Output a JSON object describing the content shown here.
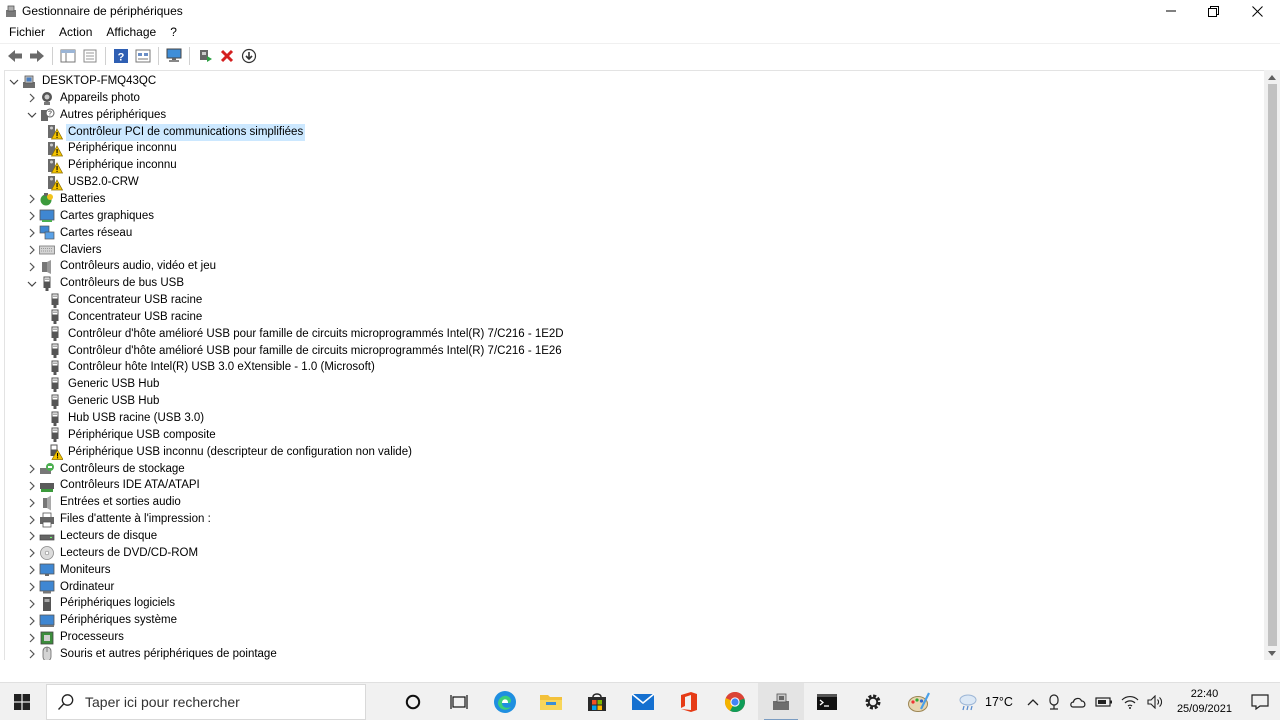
{
  "window": {
    "title": "Gestionnaire de périphériques"
  },
  "menu": [
    "Fichier",
    "Action",
    "Affichage",
    "?"
  ],
  "tree": {
    "root": "DESKTOP-FMQ43QC",
    "items": [
      {
        "label": "Appareils photo",
        "level": 1,
        "expander": "collapsed",
        "icon": "camera-icon"
      },
      {
        "label": "Autres périphériques",
        "level": 1,
        "expander": "expanded",
        "icon": "unknown-device-icon"
      },
      {
        "label": "Contrôleur PCI de communications simplifiées",
        "level": 2,
        "expander": "none",
        "icon": "warning-device-icon",
        "selected": true
      },
      {
        "label": "Périphérique inconnu",
        "level": 2,
        "expander": "none",
        "icon": "warning-device-icon"
      },
      {
        "label": "Périphérique inconnu",
        "level": 2,
        "expander": "none",
        "icon": "warning-device-icon"
      },
      {
        "label": "USB2.0-CRW",
        "level": 2,
        "expander": "none",
        "icon": "warning-device-icon"
      },
      {
        "label": "Batteries",
        "level": 1,
        "expander": "collapsed",
        "icon": "battery-icon"
      },
      {
        "label": "Cartes graphiques",
        "level": 1,
        "expander": "collapsed",
        "icon": "display-adapter-icon"
      },
      {
        "label": "Cartes réseau",
        "level": 1,
        "expander": "collapsed",
        "icon": "network-adapter-icon"
      },
      {
        "label": "Claviers",
        "level": 1,
        "expander": "collapsed",
        "icon": "keyboard-icon"
      },
      {
        "label": "Contrôleurs audio, vidéo et jeu",
        "level": 1,
        "expander": "collapsed",
        "icon": "speaker-icon"
      },
      {
        "label": "Contrôleurs de bus USB",
        "level": 1,
        "expander": "expanded",
        "icon": "usb-icon"
      },
      {
        "label": "Concentrateur USB racine",
        "level": 2,
        "expander": "none",
        "icon": "usb-icon"
      },
      {
        "label": "Concentrateur USB racine",
        "level": 2,
        "expander": "none",
        "icon": "usb-icon"
      },
      {
        "label": "Contrôleur d'hôte amélioré USB pour famille de circuits microprogrammés Intel(R) 7/C216 - 1E2D",
        "level": 2,
        "expander": "none",
        "icon": "usb-icon"
      },
      {
        "label": "Contrôleur d'hôte amélioré USB pour famille de circuits microprogrammés Intel(R) 7/C216 - 1E26",
        "level": 2,
        "expander": "none",
        "icon": "usb-icon"
      },
      {
        "label": "Contrôleur hôte Intel(R) USB 3.0 eXtensible - 1.0 (Microsoft)",
        "level": 2,
        "expander": "none",
        "icon": "usb-icon"
      },
      {
        "label": "Generic USB Hub",
        "level": 2,
        "expander": "none",
        "icon": "usb-icon"
      },
      {
        "label": "Generic USB Hub",
        "level": 2,
        "expander": "none",
        "icon": "usb-icon"
      },
      {
        "label": "Hub USB racine (USB 3.0)",
        "level": 2,
        "expander": "none",
        "icon": "usb-icon"
      },
      {
        "label": "Périphérique USB composite",
        "level": 2,
        "expander": "none",
        "icon": "usb-icon"
      },
      {
        "label": "Périphérique USB inconnu (descripteur de configuration non valide)",
        "level": 2,
        "expander": "none",
        "icon": "usb-warning-icon"
      },
      {
        "label": "Contrôleurs de stockage",
        "level": 1,
        "expander": "collapsed",
        "icon": "storage-controller-icon"
      },
      {
        "label": "Contrôleurs IDE ATA/ATAPI",
        "level": 1,
        "expander": "collapsed",
        "icon": "ide-controller-icon"
      },
      {
        "label": "Entrées et sorties audio",
        "level": 1,
        "expander": "collapsed",
        "icon": "audio-io-icon"
      },
      {
        "label": "Files d'attente à l'impression :",
        "level": 1,
        "expander": "collapsed",
        "icon": "printer-icon"
      },
      {
        "label": "Lecteurs de disque",
        "level": 1,
        "expander": "collapsed",
        "icon": "disk-drive-icon"
      },
      {
        "label": "Lecteurs de DVD/CD-ROM",
        "level": 1,
        "expander": "collapsed",
        "icon": "dvd-icon"
      },
      {
        "label": "Moniteurs",
        "level": 1,
        "expander": "collapsed",
        "icon": "monitor-icon"
      },
      {
        "label": "Ordinateur",
        "level": 1,
        "expander": "collapsed",
        "icon": "computer-icon"
      },
      {
        "label": "Périphériques logiciels",
        "level": 1,
        "expander": "collapsed",
        "icon": "software-device-icon"
      },
      {
        "label": "Périphériques système",
        "level": 1,
        "expander": "collapsed",
        "icon": "system-device-icon"
      },
      {
        "label": "Processeurs",
        "level": 1,
        "expander": "collapsed",
        "icon": "processor-icon"
      },
      {
        "label": "Souris et autres périphériques de pointage",
        "level": 1,
        "expander": "collapsed",
        "icon": "mouse-icon"
      }
    ]
  },
  "taskbar": {
    "search_placeholder": "Taper ici pour rechercher",
    "apps": [
      "cortana-icon",
      "task-view-icon",
      "edge-icon",
      "file-explorer-icon",
      "store-icon",
      "mail-icon",
      "office-icon",
      "chrome-icon",
      "device-manager-icon",
      "terminal-icon",
      "settings-icon",
      "paint-icon"
    ],
    "temperature": "17°C",
    "time": "22:40",
    "date": "25/09/2021"
  },
  "colors": {
    "selection": "#cce8ff",
    "taskbar_bg": "#f1f1f1",
    "warning": "#f5c400",
    "usb_gray": "#5a5a5a"
  }
}
